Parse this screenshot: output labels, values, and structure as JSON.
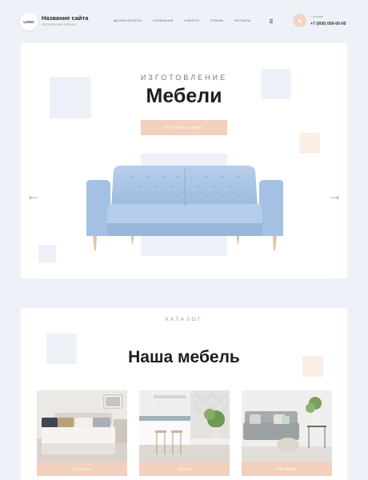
{
  "header": {
    "logo": "LOGO",
    "site_name": "Название сайта",
    "site_desc": "Изготовление мебели",
    "nav": [
      "Дизайн-проекты",
      "О компании",
      "Новости",
      "Отзывы",
      "Контакты"
    ],
    "city": "г. Москва",
    "phone": "+7 (000) 000-00-00"
  },
  "hero": {
    "subtitle": "Изготовление",
    "title": "Мебели",
    "button": "Оставить заявку"
  },
  "catalog": {
    "subtitle": "Каталог",
    "title": "Наша мебель",
    "cards": [
      {
        "label": "Спальни"
      },
      {
        "label": "Кухни"
      },
      {
        "label": "Гостиные"
      }
    ]
  },
  "colors": {
    "accent": "#f1d1bd",
    "background": "#eef2f8",
    "sofa": "#a9c4e4"
  }
}
